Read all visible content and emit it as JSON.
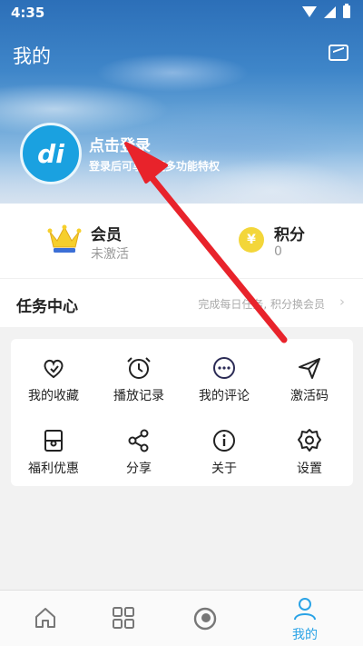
{
  "status_bar": {
    "time": "4:35"
  },
  "header": {
    "title": "我的",
    "login_title": "点击登录",
    "login_subtitle": "登录后可享受更多功能特权",
    "avatar_text": "di"
  },
  "member": {
    "vip_label": "会员",
    "vip_status": "未激活",
    "points_label": "积分",
    "points_value": "0",
    "coin_symbol": "¥"
  },
  "tasks": {
    "title": "任务中心",
    "hint": "完成每日任务, 积分换会员",
    "chevron": "›"
  },
  "grid": {
    "items": [
      {
        "label": "我的收藏",
        "icon": "heart-icon"
      },
      {
        "label": "播放记录",
        "icon": "clock-icon"
      },
      {
        "label": "我的评论",
        "icon": "comment-icon"
      },
      {
        "label": "激活码",
        "icon": "send-icon"
      },
      {
        "label": "福利优惠",
        "icon": "gift-icon"
      },
      {
        "label": "分享",
        "icon": "share-icon"
      },
      {
        "label": "关于",
        "icon": "info-icon"
      },
      {
        "label": "设置",
        "icon": "gear-icon"
      }
    ]
  },
  "tabbar": {
    "tabs": [
      {
        "label": "",
        "icon": "home-icon"
      },
      {
        "label": "",
        "icon": "grid-icon"
      },
      {
        "label": "",
        "icon": "record-icon"
      },
      {
        "label": "我的",
        "icon": "user-icon",
        "active": true
      }
    ]
  },
  "colors": {
    "accent": "#2aa3e6",
    "arrow": "#e8232b",
    "avatar": "#1aa1e0"
  }
}
